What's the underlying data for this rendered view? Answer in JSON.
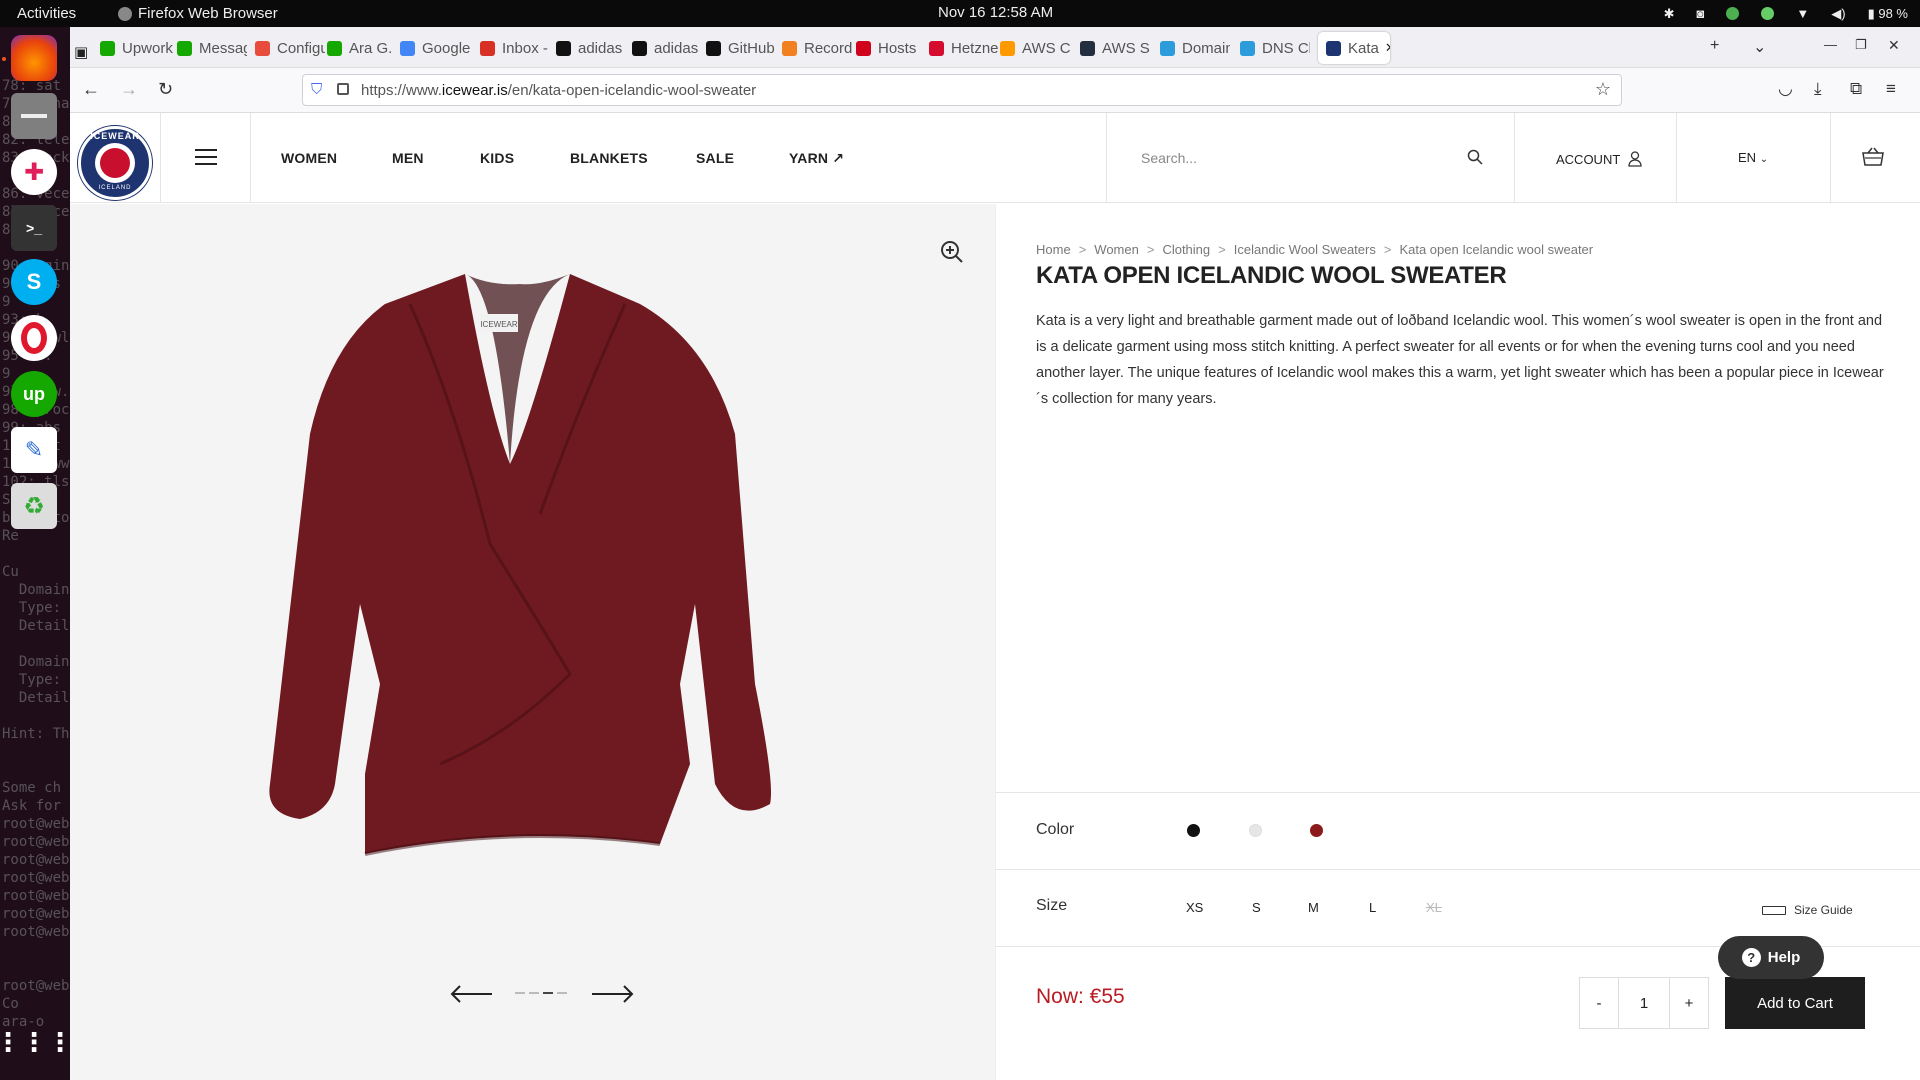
{
  "system": {
    "activities": "Activities",
    "app_name": "Firefox Web Browser",
    "clock": "Nov 16  12:58 AM",
    "battery": "98 %"
  },
  "dock": {
    "terminal_lines": [
      "78: sat",
      "79: seha",
      "8",
      "82: tele",
      "83: lock",
      "",
      "86: vece",
      "87: vece",
      "8",
      "",
      "90: zgin",
      "91: xps",
      "9",
      "93: k",
      "94: newl",
      "95 ww.",
      "9",
      "97: www.",
      "98: proc",
      "99: abs",
      "100: at",
      "101: www",
      "102: tls",
      "Se",
      "blank to",
      "Re",
      "",
      "Cu",
      "  Domain",
      "  Type:",
      "  Detail",
      "",
      "  Domain",
      "  Type:",
      "  Detail",
      "",
      "Hint: Th",
      "",
      "",
      "Some ch",
      "Ask for",
      "root@web",
      "root@web",
      "root@web",
      "root@web",
      "root@web",
      "root@web",
      "root@web",
      "",
      "",
      "root@web",
      "Co",
      "ara-o"
    ]
  },
  "tabs": [
    {
      "label": "Upwork",
      "color": "#14a800"
    },
    {
      "label": "Messag",
      "color": "#14a800"
    },
    {
      "label": "Configu",
      "color": "#e84c3d"
    },
    {
      "label": "Ara G.",
      "color": "#14a800"
    },
    {
      "label": "Google",
      "color": "#4285f4"
    },
    {
      "label": "Inbox -",
      "color": "#d93025"
    },
    {
      "label": "adidas",
      "color": "#111111"
    },
    {
      "label": "adidas",
      "color": "#111111"
    },
    {
      "label": "GitHub",
      "color": "#111111"
    },
    {
      "label": "Record",
      "color": "#f38020"
    },
    {
      "label": "Hosts",
      "color": "#d0021b"
    },
    {
      "label": "Hetzne",
      "color": "#d50c2d"
    },
    {
      "label": "AWS C",
      "color": "#ff9900"
    },
    {
      "label": "AWS S",
      "color": "#232f3e"
    },
    {
      "label": "Domain",
      "color": "#2d9cdb"
    },
    {
      "label": "DNS Ch",
      "color": "#2d9cdb"
    },
    {
      "label": "Kata",
      "color": "#1e3470"
    }
  ],
  "url": {
    "prefix": "https://www.",
    "domain": "icewear.is",
    "path": "/en/kata-open-icelandic-wool-sweater"
  },
  "site": {
    "logo_text": "ICEWEAR",
    "logo_sub": "ICELAND",
    "nav": [
      "WOMEN",
      "MEN",
      "KIDS",
      "BLANKETS",
      "SALE",
      "YARN ↗"
    ],
    "search_placeholder": "Search...",
    "account": "ACCOUNT",
    "lang": "EN"
  },
  "product": {
    "breadcrumbs": [
      "Home",
      "Women",
      "Clothing",
      "Icelandic Wool Sweaters",
      "Kata open Icelandic wool sweater"
    ],
    "title": "KATA OPEN ICELANDIC WOOL SWEATER",
    "description": "Kata is a very light and breathable garment made out of loðband Icelandic wool. This women´s wool sweater is open in the front and is a delicate garment using moss stitch knitting. A perfect sweater for all events or for when the evening turns cool and you need another layer. The unique features of Icelandic wool makes this a warm, yet light sweater which has been a popular piece in Icewear´s collection for many years.",
    "color_label": "Color",
    "colors": [
      "#111111",
      "#e6e6e6",
      "#8b1a1a"
    ],
    "size_label": "Size",
    "sizes": [
      {
        "label": "XS",
        "available": true
      },
      {
        "label": "S",
        "available": true
      },
      {
        "label": "M",
        "available": true
      },
      {
        "label": "L",
        "available": true
      },
      {
        "label": "XL",
        "available": false
      }
    ],
    "size_guide": "Size Guide",
    "price": "Now: €55",
    "qty_minus": "-",
    "qty_value": "1",
    "qty_plus": "+",
    "add_to_cart": "Add to Cart",
    "sweater_color": "#6e1a20",
    "tag_text": "ICEWEAR"
  },
  "help": {
    "label": "Help",
    "q": "?"
  }
}
